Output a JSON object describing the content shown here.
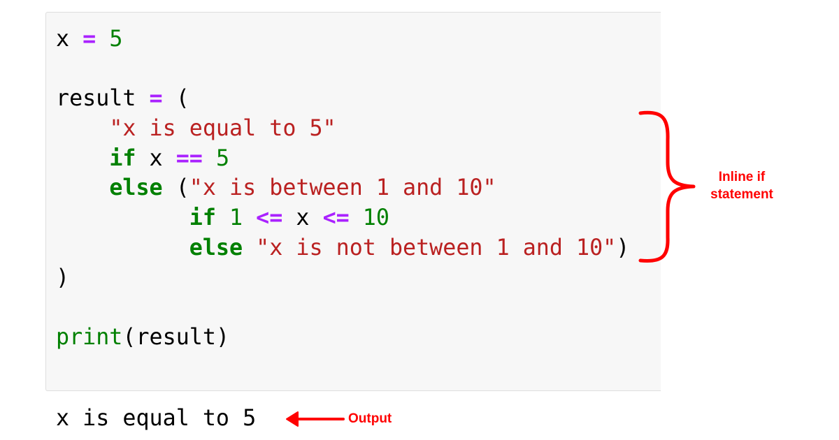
{
  "code_cell": {
    "lines": [
      [
        {
          "t": "name",
          "v": "x"
        },
        {
          "t": "ws",
          "v": " "
        },
        {
          "t": "op",
          "v": "="
        },
        {
          "t": "ws",
          "v": " "
        },
        {
          "t": "num",
          "v": "5"
        }
      ],
      [],
      [
        {
          "t": "name",
          "v": "result"
        },
        {
          "t": "ws",
          "v": " "
        },
        {
          "t": "op",
          "v": "="
        },
        {
          "t": "ws",
          "v": " "
        },
        {
          "t": "punct",
          "v": "("
        }
      ],
      [
        {
          "t": "ws",
          "v": "    "
        },
        {
          "t": "str",
          "v": "\"x is equal to 5\""
        }
      ],
      [
        {
          "t": "ws",
          "v": "    "
        },
        {
          "t": "kw",
          "v": "if"
        },
        {
          "t": "ws",
          "v": " "
        },
        {
          "t": "name",
          "v": "x"
        },
        {
          "t": "ws",
          "v": " "
        },
        {
          "t": "op",
          "v": "=="
        },
        {
          "t": "ws",
          "v": " "
        },
        {
          "t": "num",
          "v": "5"
        }
      ],
      [
        {
          "t": "ws",
          "v": "    "
        },
        {
          "t": "kw",
          "v": "else"
        },
        {
          "t": "ws",
          "v": " "
        },
        {
          "t": "punct",
          "v": "("
        },
        {
          "t": "str",
          "v": "\"x is between 1 and 10\""
        }
      ],
      [
        {
          "t": "ws",
          "v": "          "
        },
        {
          "t": "kw",
          "v": "if"
        },
        {
          "t": "ws",
          "v": " "
        },
        {
          "t": "num",
          "v": "1"
        },
        {
          "t": "ws",
          "v": " "
        },
        {
          "t": "op",
          "v": "<="
        },
        {
          "t": "ws",
          "v": " "
        },
        {
          "t": "name",
          "v": "x"
        },
        {
          "t": "ws",
          "v": " "
        },
        {
          "t": "op",
          "v": "<="
        },
        {
          "t": "ws",
          "v": " "
        },
        {
          "t": "num",
          "v": "10"
        }
      ],
      [
        {
          "t": "ws",
          "v": "          "
        },
        {
          "t": "kw",
          "v": "else"
        },
        {
          "t": "ws",
          "v": " "
        },
        {
          "t": "str",
          "v": "\"x is not between 1 and 10\""
        },
        {
          "t": "punct",
          "v": ")"
        }
      ],
      [
        {
          "t": "punct",
          "v": ")"
        }
      ],
      [],
      [
        {
          "t": "builtin",
          "v": "print"
        },
        {
          "t": "punct",
          "v": "("
        },
        {
          "t": "name",
          "v": "result"
        },
        {
          "t": "punct",
          "v": ")"
        }
      ]
    ]
  },
  "output": {
    "text": "x is equal to 5"
  },
  "annotations": {
    "brace_label_line1": "Inline if",
    "brace_label_line2": "statement",
    "arrow_label": "Output",
    "color": "#ff0000"
  },
  "syntax_colors": {
    "keyword": "#008000",
    "number": "#008000",
    "operator": "#aa22ff",
    "string": "#ba2121",
    "default": "#000000",
    "cell_background": "#f7f7f7"
  }
}
